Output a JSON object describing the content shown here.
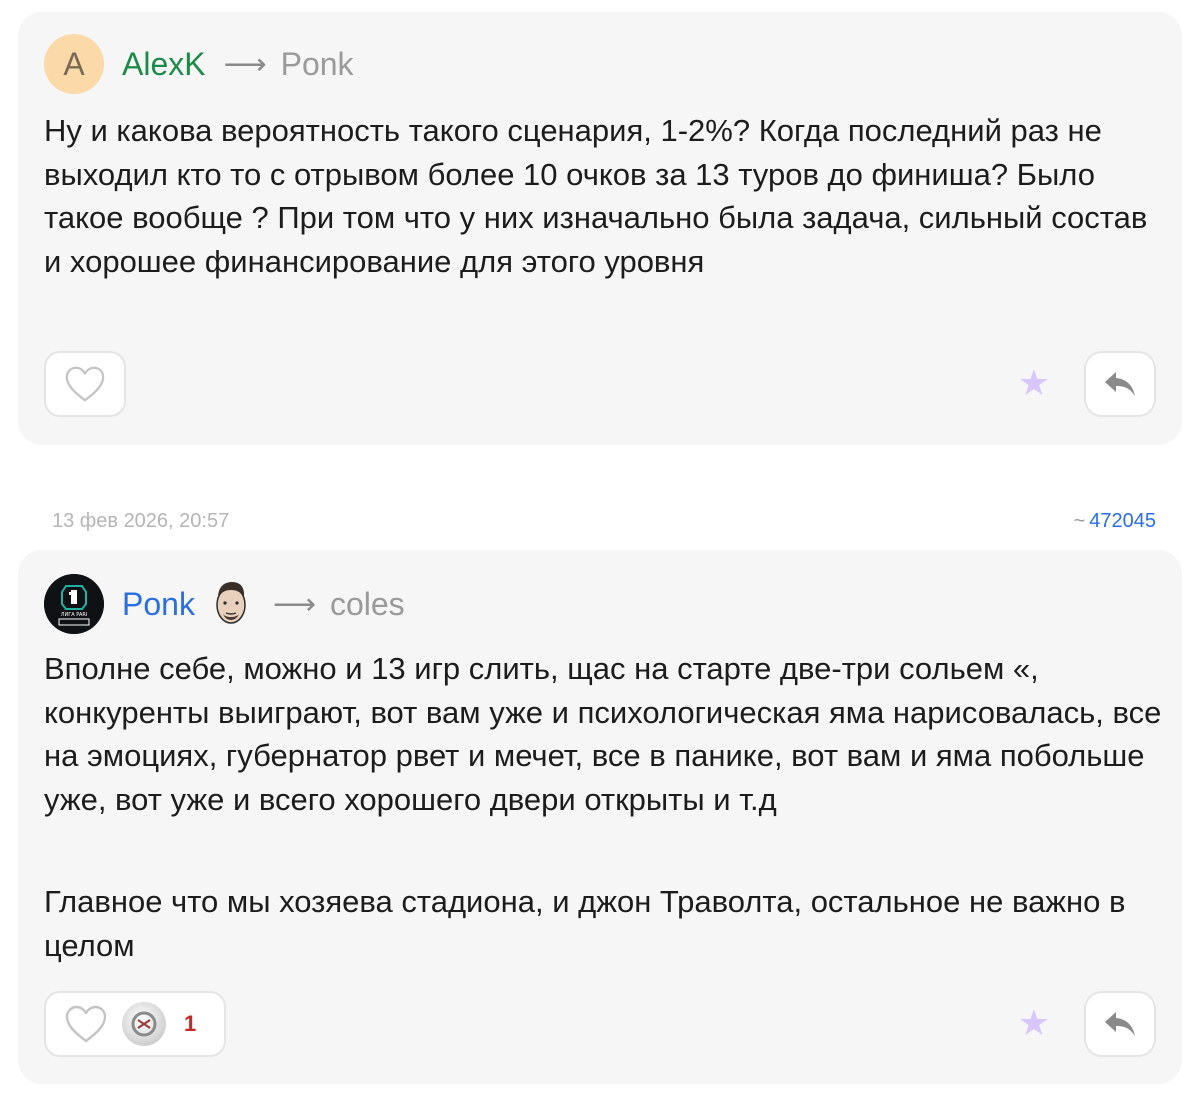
{
  "comments": [
    {
      "avatar_letter": "A",
      "author": "AlexK",
      "arrow": "⟶",
      "recipient": "Ponk",
      "paragraphs": [
        "Ну и какова вероятность такого сценария, 1-2%? Когда последний раз не выходил кто то с отрывом более 10 очков за 13 туров до финиша? Было такое вообще ? При том что у них изначально была задача, сильный состав и хорошее финансирование для этого уровня"
      ],
      "like_icon": "heart-outline-icon",
      "favorite_icon": "star-icon",
      "reply_icon": "reply-arrow-icon"
    },
    {
      "date": "13 фев 2026, 20:57",
      "id_prefix": "~",
      "id": "472045",
      "avatar_label": "ЛИГА PARI",
      "author": "Ponk",
      "arrow": "⟶",
      "recipient": "coles",
      "paragraphs": [
        "Вполне себе, можно и 13 игр слить, щас на старте две-три сольем «, конкуренты выиграют, вот вам уже и психологическая яма нарисовалась, все на эмоциях, губернатор рвет и мечет, все в панике, вот вам и яма побольше уже, вот уже и всего хорошего двери открыты и т.д",
        "Главное что мы хозяева стадиона, и джон Траволта, остальное не важно в целом"
      ],
      "like_count": "1",
      "like_icon": "heart-outline-icon",
      "favorite_icon": "star-icon",
      "reply_icon": "reply-arrow-icon"
    }
  ],
  "colors": {
    "card_bg": "#f6f6f6",
    "author_green": "#1e8a4a",
    "author_blue": "#2a6fe0",
    "star": "#d9c7fb",
    "like_count": "#c52a2a"
  }
}
